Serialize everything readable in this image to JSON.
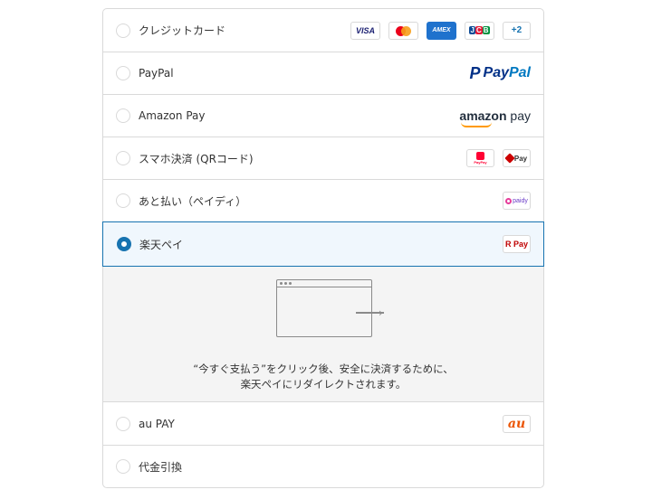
{
  "payment_methods": [
    {
      "label": "クレジットカード"
    },
    {
      "label": "PayPal"
    },
    {
      "label": "Amazon Pay"
    },
    {
      "label": "スマホ決済 (QRコード)"
    },
    {
      "label": "あと払い（ペイディ）"
    },
    {
      "label": "楽天ペイ"
    },
    {
      "label": "au PAY"
    },
    {
      "label": "代金引換"
    }
  ],
  "selected_method": "楽天ペイ",
  "card_brands": {
    "visa": "VISA",
    "amex": "AMEX",
    "jcb_j": "J",
    "jcb_c": "C",
    "jcb_b": "B",
    "more": "+2"
  },
  "logos": {
    "paypal_mark": "P",
    "paypal_pay": "Pay",
    "paypal_pal": "Pal",
    "amazon_a": "amazon",
    "amazon_b": " pay",
    "paypay_small": "PayPay",
    "dpay": "Pay",
    "paidy": "paidy",
    "rpay": "R Pay",
    "au": "au"
  },
  "redirect_notice": {
    "line1": "“今すぐ支払う”をクリック後、安全に決済するために、",
    "line2": "楽天ペイにリダイレクトされます。"
  },
  "colors": {
    "accent": "#1773b0",
    "selected_bg": "#f0f7fd",
    "expand_bg": "#f4f4f4",
    "border": "#d9d9d9"
  }
}
